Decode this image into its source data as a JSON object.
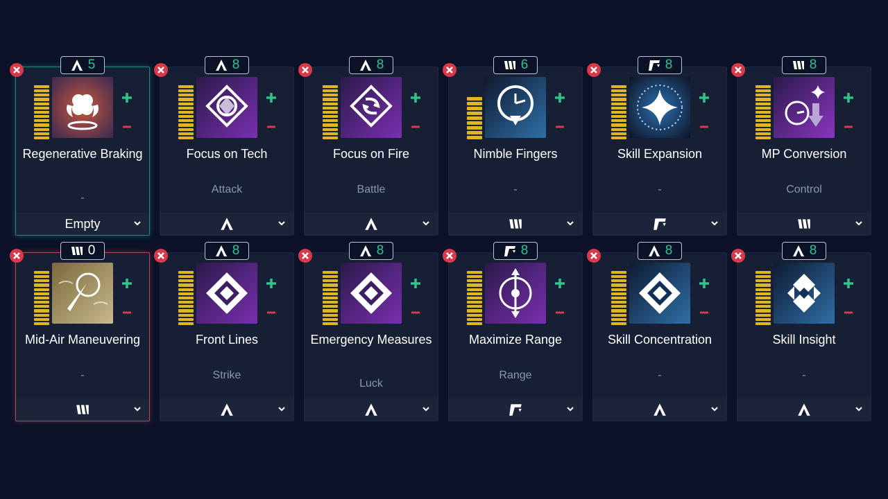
{
  "colors": {
    "background": "#0b1228",
    "card": "#161f33",
    "bar": "#e0b620",
    "plus": "#2ec48e",
    "minus": "#d8394b",
    "level": "#2ec48e"
  },
  "cards": [
    {
      "name": "Regenerative Braking",
      "type_icon": "arrow-a-icon",
      "level": "5",
      "sub": "-",
      "footer": "Empty",
      "footer_icon": "",
      "bars": 13,
      "art": "clover",
      "state": "teal"
    },
    {
      "name": "Focus on Tech",
      "type_icon": "arrow-a-icon",
      "level": "8",
      "sub": "Attack",
      "footer": "",
      "footer_icon": "arrow-a-icon",
      "bars": 13,
      "art": "tech",
      "state": ""
    },
    {
      "name": "Focus on Fire",
      "type_icon": "arrow-a-icon",
      "level": "8",
      "sub": "Battle",
      "footer": "",
      "footer_icon": "arrow-a-icon",
      "bars": 13,
      "art": "fire",
      "state": ""
    },
    {
      "name": "Nimble Fingers",
      "type_icon": "bars-m-icon",
      "level": "6",
      "sub": "-",
      "footer": "",
      "footer_icon": "bars-m-icon",
      "bars": 9,
      "art": "clock-down",
      "state": ""
    },
    {
      "name": "Skill Expansion",
      "type_icon": "slash-r-icon",
      "level": "8",
      "sub": "-",
      "footer": "",
      "footer_icon": "slash-r-icon",
      "bars": 13,
      "art": "sparkle",
      "state": ""
    },
    {
      "name": "MP Conversion",
      "type_icon": "bars-m-icon",
      "level": "8",
      "sub": "Control",
      "footer": "",
      "footer_icon": "bars-m-icon",
      "bars": 13,
      "art": "mp",
      "state": ""
    },
    {
      "name": "Mid-Air Maneuvering",
      "type_icon": "bars-m-icon",
      "level": "0",
      "sub": "-",
      "footer": "",
      "footer_icon": "bars-m-icon",
      "bars": 13,
      "art": "midair",
      "state": "red",
      "level_white": true
    },
    {
      "name": "Front Lines",
      "type_icon": "arrow-a-icon",
      "level": "8",
      "sub": "Strike",
      "footer": "",
      "footer_icon": "arrow-a-icon",
      "bars": 13,
      "art": "diamond",
      "state": ""
    },
    {
      "name": "Emergency Measures",
      "type_icon": "arrow-a-icon",
      "level": "8",
      "sub": "Luck",
      "footer": "",
      "footer_icon": "arrow-a-icon",
      "bars": 13,
      "art": "diamond",
      "state": ""
    },
    {
      "name": "Maximize Range",
      "type_icon": "slash-r-icon",
      "level": "8",
      "sub": "Range",
      "footer": "",
      "footer_icon": "slash-r-icon",
      "bars": 13,
      "art": "range",
      "state": ""
    },
    {
      "name": "Skill Concentration",
      "type_icon": "arrow-a-icon",
      "level": "8",
      "sub": "-",
      "footer": "",
      "footer_icon": "arrow-a-icon",
      "bars": 13,
      "art": "diamond-blue",
      "state": ""
    },
    {
      "name": "Skill Insight",
      "type_icon": "arrow-a-icon",
      "level": "8",
      "sub": "-",
      "footer": "",
      "footer_icon": "arrow-a-icon",
      "bars": 13,
      "art": "insight",
      "state": ""
    }
  ]
}
